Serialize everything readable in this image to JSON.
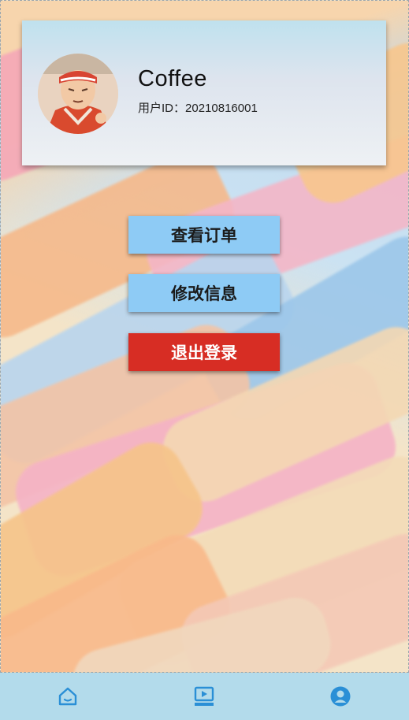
{
  "profile": {
    "username": "Coffee",
    "user_id_label": "用户ID：",
    "user_id": "20210816001"
  },
  "actions": {
    "view_orders": "查看订单",
    "edit_info": "修改信息",
    "logout": "退出登录"
  },
  "colors": {
    "action_button": "#8ecbf5",
    "logout_button": "#d72d24",
    "tab_icon": "#2a8fd6",
    "tab_bar": "#b3dbeb"
  },
  "tabbar": {
    "tabs": [
      {
        "name": "home",
        "icon": "home-icon"
      },
      {
        "name": "video",
        "icon": "video-icon"
      },
      {
        "name": "profile",
        "icon": "user-icon",
        "active": true
      }
    ]
  }
}
